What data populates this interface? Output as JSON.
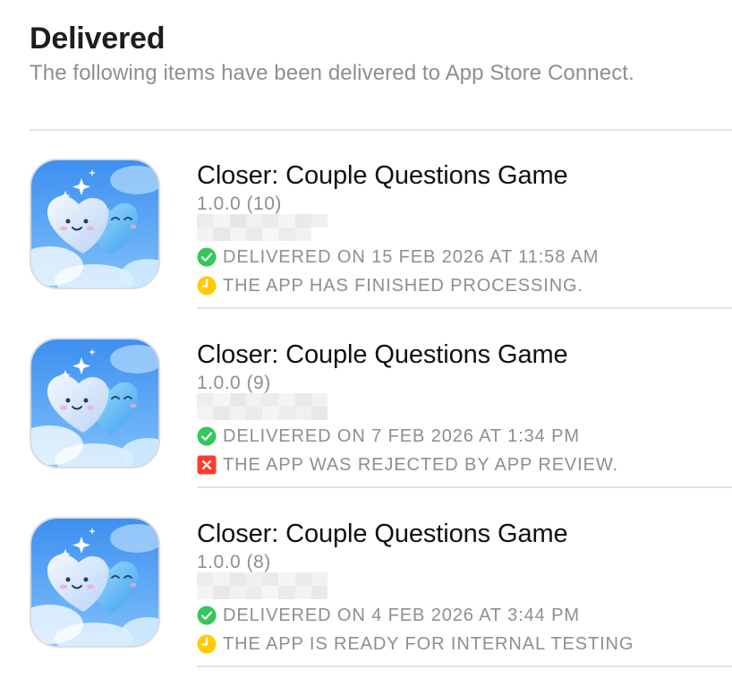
{
  "header": {
    "title": "Delivered",
    "subtitle": "The following items have been delivered to App Store Connect."
  },
  "colors": {
    "success": "#34c759",
    "pending": "#ffcc00",
    "error": "#ff3b30",
    "secondary_text": "#8e8e93"
  },
  "items": [
    {
      "name": "Closer: Couple Questions Game",
      "version": "1.0.0 (10)",
      "delivered_status": "DELIVERED ON 15 FEB 2026 AT 11:58 AM",
      "delivered_icon": "checkmark-circle-icon",
      "processing_status": "THE APP HAS FINISHED PROCESSING.",
      "processing_icon": "clock-icon"
    },
    {
      "name": "Closer: Couple Questions Game",
      "version": "1.0.0 (9)",
      "delivered_status": "DELIVERED ON 7 FEB 2026 AT 1:34 PM",
      "delivered_icon": "checkmark-circle-icon",
      "processing_status": "THE APP WAS REJECTED BY APP REVIEW.",
      "processing_icon": "x-square-icon"
    },
    {
      "name": "Closer: Couple Questions Game",
      "version": "1.0.0 (8)",
      "delivered_status": "DELIVERED ON 4 FEB 2026 AT 3:44 PM",
      "delivered_icon": "checkmark-circle-icon",
      "processing_status": "THE APP IS READY FOR INTERNAL TESTING",
      "processing_icon": "clock-icon"
    }
  ]
}
